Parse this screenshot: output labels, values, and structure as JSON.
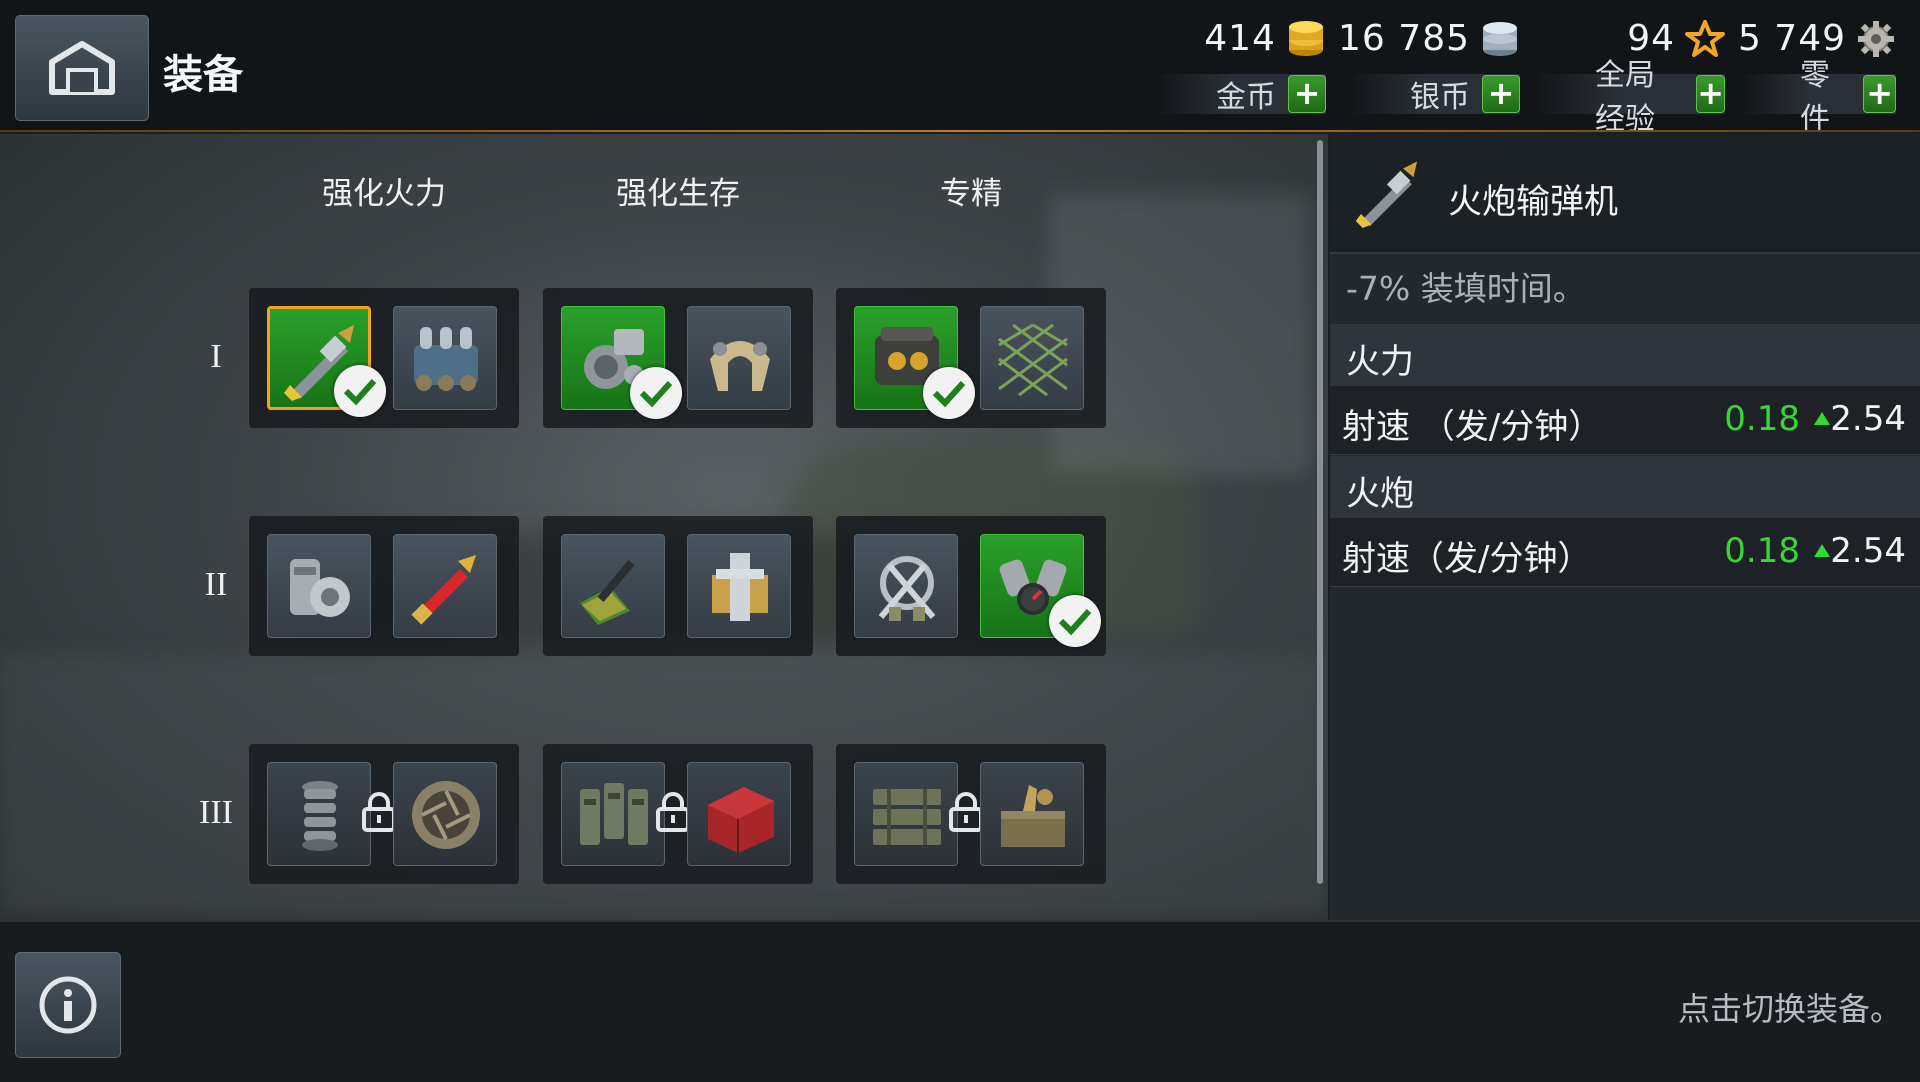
{
  "header": {
    "title": "装备",
    "currencies": [
      {
        "amount": "414",
        "label": "金币",
        "icon": "gold-coin-icon"
      },
      {
        "amount": "16 785",
        "label": "银币",
        "icon": "silver-coin-icon"
      },
      {
        "amount": "94",
        "label": "全局经验",
        "icon": "star-icon"
      },
      {
        "amount": "5 749",
        "label": "零件",
        "icon": "gear-icon"
      }
    ]
  },
  "columns": [
    "强化火力",
    "强化生存",
    "专精"
  ],
  "tiers": [
    "I",
    "II",
    "III"
  ],
  "slots": [
    [
      [
        "rammer",
        "ammo-pack"
      ],
      [
        "engine-parts",
        "armor-plating"
      ],
      [
        "optics",
        "camo-net"
      ]
    ],
    [
      [
        "gun-mechanism",
        "shell-red"
      ],
      [
        "bayonet-wrench",
        "armored-hatch"
      ],
      [
        "crossed-tools",
        "turbo-engine"
      ]
    ],
    [
      [
        "spring-coil",
        "aperture"
      ],
      [
        "tracks",
        "toolbox"
      ],
      [
        "ammo-crates",
        "supply-box"
      ]
    ]
  ],
  "selected_module": {
    "name": "火炮输弹机",
    "description": "-7% 装填时间。",
    "sections": [
      {
        "title": "火力",
        "rows": [
          {
            "name": "射速 （发/分钟）",
            "delta": "0.18",
            "value": "2.54"
          }
        ]
      },
      {
        "title": "火炮",
        "rows": [
          {
            "name": "射速（发/分钟）",
            "delta": "0.18",
            "value": "2.54"
          }
        ]
      }
    ]
  },
  "footer": {
    "hint": "点击切换装备。"
  },
  "colors": {
    "accent": "#f3a21f",
    "positive": "#33d833",
    "equipped": "#1f8a1f"
  }
}
